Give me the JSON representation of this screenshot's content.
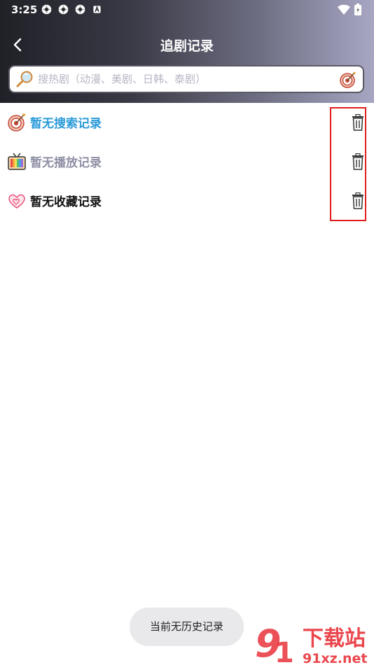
{
  "status_bar": {
    "time": "3:25",
    "left_icons": [
      "settings-icon",
      "settings-icon",
      "settings-icon",
      "a-icon"
    ],
    "right_icons": [
      "wifi-icon",
      "battery-icon"
    ]
  },
  "header": {
    "title": "追剧记录",
    "back_icon": "chevron-left-icon"
  },
  "search": {
    "placeholder": "搜热剧（动漫、美剧、日韩、泰剧）",
    "value": ""
  },
  "rows": [
    {
      "label": "暂无搜索记录",
      "color": "#2a9ad8",
      "icon": "target-icon"
    },
    {
      "label": "暂无播放记录",
      "color": "#8f8fa6",
      "icon": "tv-icon"
    },
    {
      "label": "暂无收藏记录",
      "color": "#111111",
      "icon": "heart-icon"
    }
  ],
  "toast": {
    "text": "当前无历史记录"
  },
  "watermark": {
    "text": "下载站",
    "domain": "91xz.net",
    "brand_color": "#e8333a"
  },
  "colors": {
    "highlight": "#e01d1d",
    "header_start": "#202027",
    "header_end": "#a7a7c4"
  }
}
